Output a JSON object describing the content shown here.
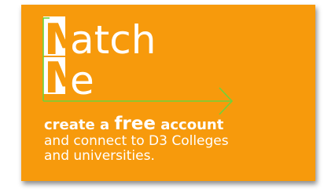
{
  "banner": {
    "brand_initial_1": "M",
    "brand_rest_1": "atch",
    "brand_initial_2": "M",
    "brand_rest_2": "e",
    "cta_prefix": "create a ",
    "cta_emphasis": "free",
    "cta_suffix": " account",
    "line2": "and connect to D3 Colleges",
    "line3": "and universities."
  },
  "colors": {
    "background": "#f79a0c",
    "text": "#ffffff",
    "arrow": "#6fd33a"
  },
  "icons": [
    "right-arrow-icon"
  ]
}
